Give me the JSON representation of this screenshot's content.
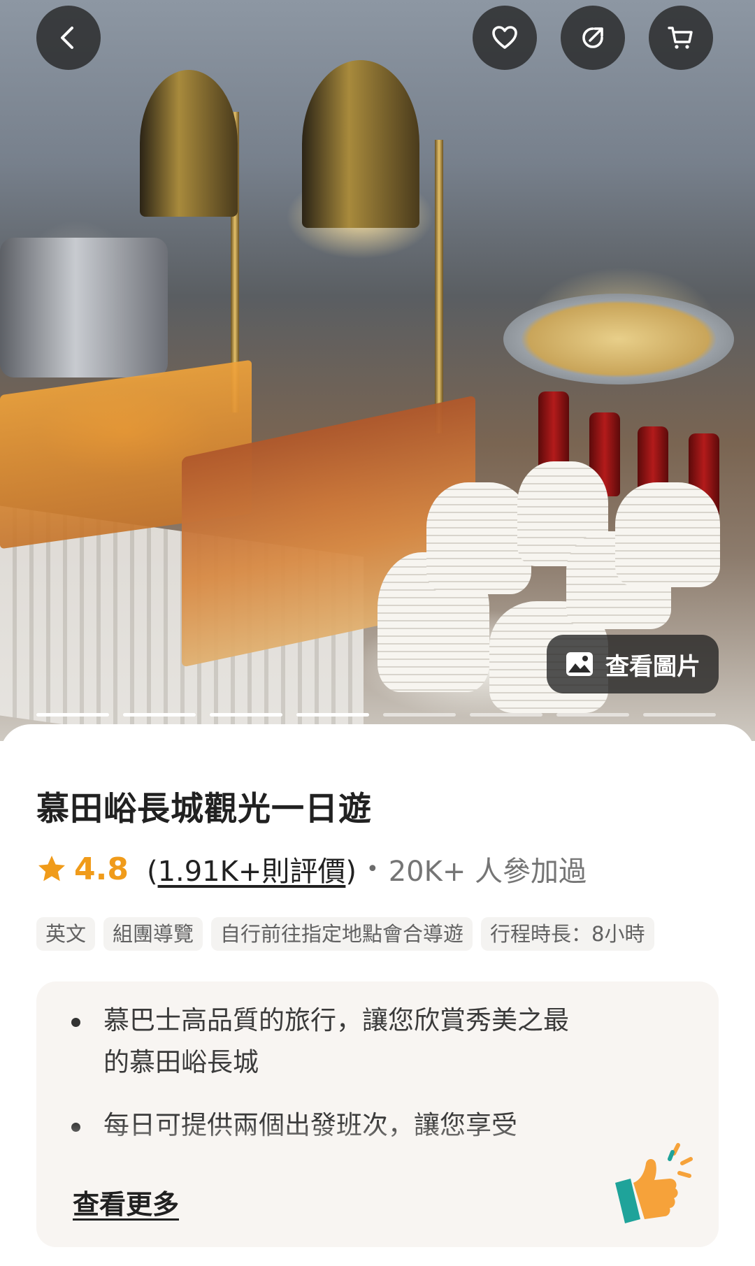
{
  "hero": {
    "view_photos_label": "查看圖片",
    "indicator_count": 8,
    "active_indicators": 4
  },
  "product": {
    "title": "慕田峪長城觀光一日遊",
    "rating": "4.8",
    "reviews_open": "(",
    "reviews_text": "1.91K+則評價",
    "reviews_close": ")",
    "separator": "•",
    "participants": "20K+ 人參加過"
  },
  "tags": [
    "英文",
    "組團導覽",
    "自行前往指定地點會合導遊",
    "行程時長：8小時"
  ],
  "highlights": {
    "items": [
      "慕巴士高品質的旅行，讓您欣賞秀美之最的慕田峪長城",
      "每日可提供兩個出發班次，讓您享受"
    ],
    "see_more": "查看更多"
  },
  "colors": {
    "accent": "#f09b1a",
    "highlight_bg": "#f8f5f2",
    "tag_bg": "#f4f3f1",
    "button_bg": "#232323"
  },
  "icons": [
    "back-arrow-icon",
    "heart-icon",
    "share-icon",
    "cart-icon",
    "image-icon",
    "star-icon",
    "thumbs-up-icon"
  ]
}
